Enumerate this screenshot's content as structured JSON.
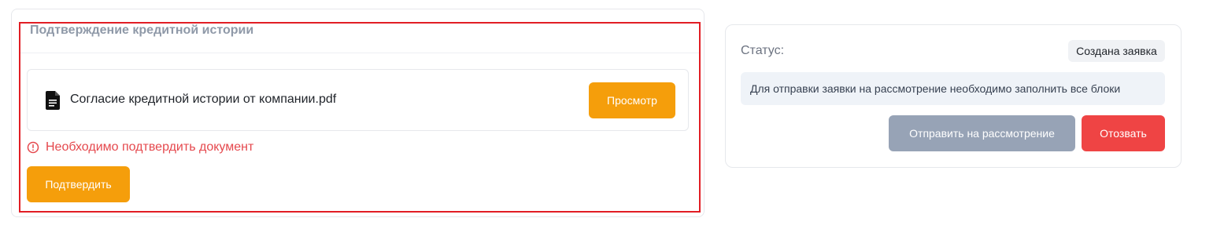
{
  "credit_section": {
    "title": "Подтверждение кредитной истории",
    "document": {
      "icon": "file-icon",
      "name": "Согласие кредитной истории от компании.pdf",
      "view_label": "Просмотр"
    },
    "error": {
      "icon": "alert-circle-icon",
      "message": "Необходимо подтвердить документ"
    },
    "confirm_label": "Подтвердить"
  },
  "status_panel": {
    "label": "Статус:",
    "badge": "Создана заявка",
    "info": "Для отправки заявки на рассмотрение необходимо заполнить все блоки",
    "submit_label": "Отправить на рассмотрение",
    "revoke_label": "Отозвать"
  },
  "colors": {
    "accent_orange": "#f59e0b",
    "error_red": "#e5484d",
    "revoke_red": "#ef4444",
    "disabled_gray": "#97a3b6",
    "highlight_border": "#e11d24"
  }
}
